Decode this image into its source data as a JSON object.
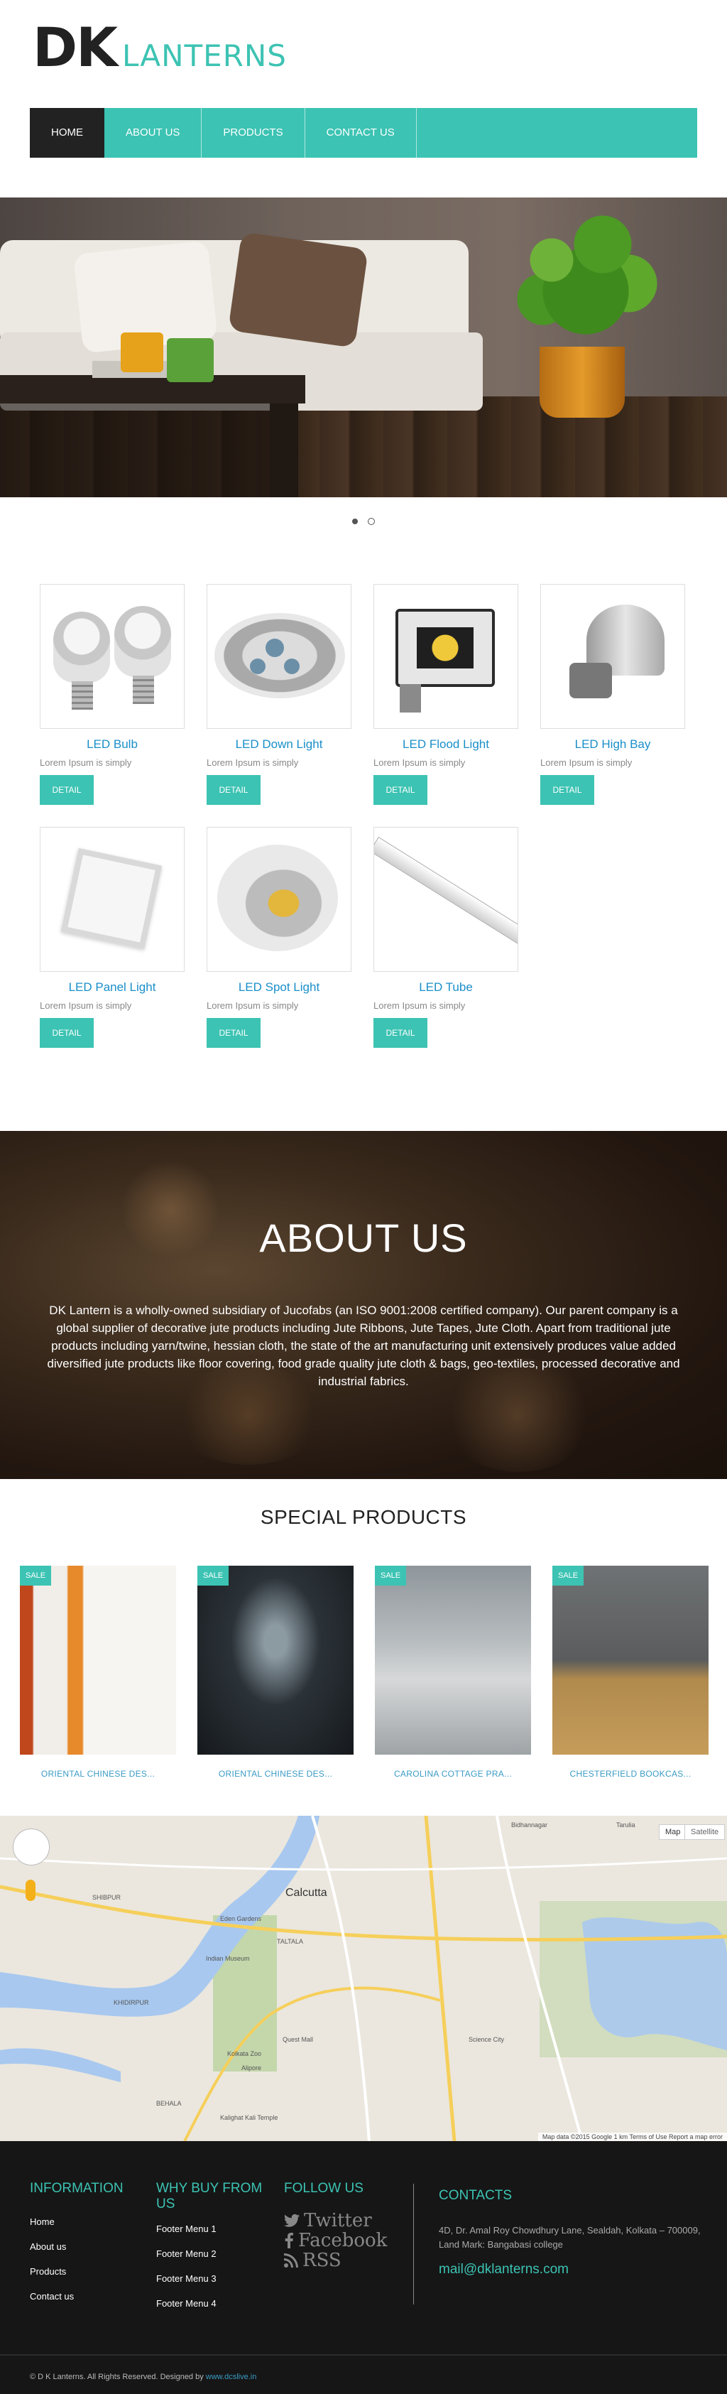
{
  "brand": {
    "logo_bold": "DK",
    "logo_light": "LANTERNS"
  },
  "nav": [
    {
      "label": "HOME",
      "active": true
    },
    {
      "label": "ABOUT US",
      "active": false
    },
    {
      "label": "PRODUCTS",
      "active": false
    },
    {
      "label": "CONTACT US",
      "active": false
    }
  ],
  "slider": {
    "slides": 2,
    "current": 1
  },
  "products": [
    {
      "title": "LED Bulb",
      "desc": "Lorem Ipsum is simply",
      "button": "DETAIL"
    },
    {
      "title": "LED Down Light",
      "desc": "Lorem Ipsum is simply",
      "button": "DETAIL"
    },
    {
      "title": "LED Flood Light",
      "desc": "Lorem Ipsum is simply",
      "button": "DETAIL"
    },
    {
      "title": "LED High Bay",
      "desc": "Lorem Ipsum is simply",
      "button": "DETAIL"
    },
    {
      "title": "LED Panel Light",
      "desc": "Lorem Ipsum is simply",
      "button": "DETAIL"
    },
    {
      "title": "LED Spot Light",
      "desc": "Lorem Ipsum is simply",
      "button": "DETAIL"
    },
    {
      "title": "LED Tube",
      "desc": "Lorem Ipsum is simply",
      "button": "DETAIL"
    }
  ],
  "about": {
    "title": "ABOUT US",
    "text": "DK Lantern is a wholly-owned subsidiary of Jucofabs (an ISO 9001:2008 certified company). Our parent company is a global supplier of decorative jute products including Jute Ribbons, Jute Tapes, Jute Cloth. Apart from traditional jute products including yarn/twine, hessian cloth, the state of the art manufacturing unit extensively produces value added diversified jute products like floor covering, food grade quality jute cloth & bags, geo-textiles, processed decorative and industrial fabrics."
  },
  "special": {
    "title": "SPECIAL PRODUCTS",
    "items": [
      {
        "badge": "SALE",
        "name": "ORIENTAL CHINESE DES..."
      },
      {
        "badge": "SALE",
        "name": "ORIENTAL CHINESE DES..."
      },
      {
        "badge": "SALE",
        "name": "CAROLINA COTTAGE PRA..."
      },
      {
        "badge": "SALE",
        "name": "CHESTERFIELD BOOKCAS..."
      }
    ]
  },
  "map": {
    "buttons": [
      "Map",
      "Satellite"
    ],
    "labels": [
      "Calcutta",
      "SHIBPUR",
      "Indian Museum",
      "Eden Gardens",
      "TALTALA",
      "KHIDIRPUR",
      "Kolkata Zoo",
      "Quest Mall",
      "Science City",
      "Tarulia",
      "Bidhannagar",
      "BEHALA",
      "Alipore",
      "Kalighat Kali Temple"
    ],
    "attribution": "Map data ©2015 Google  1 km  Terms of Use  Report a map error"
  },
  "footer": {
    "information": {
      "heading": "INFORMATION",
      "links": [
        "Home",
        "About us",
        "Products",
        "Contact us"
      ]
    },
    "why": {
      "heading": "WHY BUY FROM US",
      "links": [
        "Footer Menu 1",
        "Footer Menu 2",
        "Footer Menu 3",
        "Footer Menu 4"
      ]
    },
    "follow": {
      "heading": "FOLLOW US",
      "links": [
        "Twitter",
        "Facebook",
        "RSS"
      ]
    },
    "contacts": {
      "heading": "CONTACTS",
      "address": "4D, Dr. Amal Roy Chowdhury Lane, Sealdah, Kolkata – 700009, Land Mark: Bangabasi college",
      "email": "mail@dklanterns.com"
    },
    "copyright": "© D K Lanterns. All Rights Reserved. Designed by",
    "designer": "www.dcslive.in"
  },
  "colors": {
    "accent": "#3cc3b3",
    "link": "#1a8fc9",
    "dark": "#222222",
    "footer_bg": "#161616"
  },
  "icons": [
    "twitter-icon",
    "facebook-icon",
    "rss-icon",
    "map-pan-control-icon",
    "pegman-icon"
  ]
}
